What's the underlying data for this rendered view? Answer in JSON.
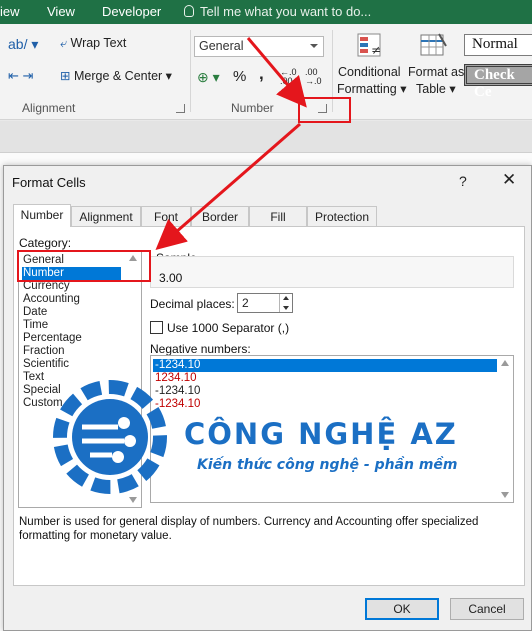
{
  "menubar": {
    "tabs": [
      "iew",
      "View",
      "Developer"
    ],
    "tell_me": "Tell me what you want to do..."
  },
  "ribbon": {
    "alignment": {
      "wrap_text": "Wrap Text",
      "merge_center": "Merge & Center",
      "group_label": "Alignment"
    },
    "number": {
      "format_value": "General",
      "percent": "%",
      "comma": ",",
      "decimal_inc": "←.0 .00",
      "decimal_dec": ".00 →.0",
      "group_label": "Number"
    },
    "styles": {
      "conditional_formatting": [
        "Conditional",
        "Formatting"
      ],
      "format_as_table": [
        "Format as",
        "Table"
      ],
      "normal": "Normal",
      "check_cell": "Check Ce"
    }
  },
  "dialog": {
    "title": "Format Cells",
    "help": "?",
    "close": "✕",
    "tabs": [
      "Number",
      "Alignment",
      "Font",
      "Border",
      "Fill",
      "Protection"
    ],
    "active_tab": "Number",
    "category_label": "Category:",
    "categories": [
      "General",
      "Number",
      "Currency",
      "Accounting",
      "Date",
      "Time",
      "Percentage",
      "Fraction",
      "Scientific",
      "Text",
      "Special",
      "Custom"
    ],
    "selected_category": "Number",
    "sample_label": "Sample",
    "sample_value": "3.00",
    "decimal_places_label": "Decimal places:",
    "decimal_places_value": "2",
    "use_1000_separator_label": "Use 1000 Separator (,)",
    "use_1000_separator_checked": false,
    "negative_numbers_label": "Negative numbers:",
    "negative_numbers": [
      {
        "text": "-1234.10",
        "color": "#ffffff",
        "selected": true
      },
      {
        "text": "1234.10",
        "color": "#c00000",
        "selected": false
      },
      {
        "text": "-1234.10",
        "color": "#111111",
        "selected": false
      },
      {
        "text": "-1234.10",
        "color": "#c00000",
        "selected": false
      }
    ],
    "description": "Number is used for general display of numbers.  Currency and Accounting offer specialized formatting for monetary value.",
    "ok": "OK",
    "cancel": "Cancel"
  },
  "watermark": {
    "title": "CÔNG NGHỆ AZ",
    "subtitle": "Kiến thức công nghệ - phần mềm",
    "color": "#1b6fc4"
  },
  "colors": {
    "excel_green": "#1f7145",
    "highlight_red": "#e4161c",
    "selection_blue": "#0078d7"
  }
}
